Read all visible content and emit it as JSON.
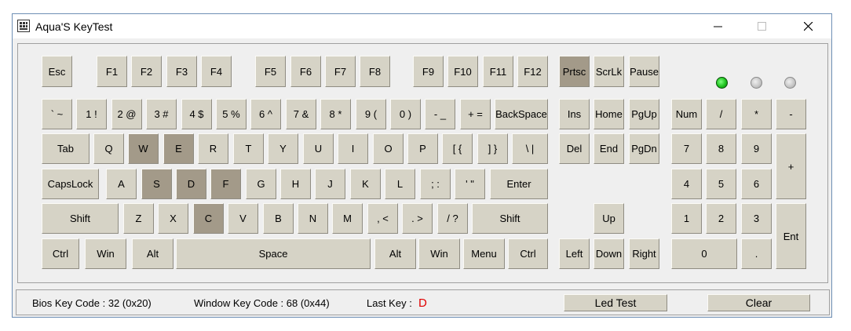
{
  "window": {
    "title": "Aqua'S KeyTest"
  },
  "leds": [
    {
      "name": "led-1",
      "state": "on"
    },
    {
      "name": "led-2",
      "state": "off"
    },
    {
      "name": "led-3",
      "state": "off"
    }
  ],
  "colors": {
    "key_face": "#d6d3c6",
    "key_pressed": "#a39a89",
    "led_on": "#1fc21f",
    "last_key_value": "#e00000"
  },
  "status": {
    "bios_key_code": "Bios Key Code : 32 (0x20)",
    "window_key_code": "Window Key Code : 68 (0x44)",
    "last_key_label": "Last Key :",
    "last_key_value": "D",
    "led_test_label": "Led Test",
    "clear_label": "Clear"
  },
  "keys": [
    {
      "label": "Esc"
    },
    {
      "label": "F1"
    },
    {
      "label": "F2"
    },
    {
      "label": "F3"
    },
    {
      "label": "F4"
    },
    {
      "label": "F5"
    },
    {
      "label": "F6"
    },
    {
      "label": "F7"
    },
    {
      "label": "F8"
    },
    {
      "label": "F9"
    },
    {
      "label": "F10"
    },
    {
      "label": "F11"
    },
    {
      "label": "F12"
    },
    {
      "label": "Prtsc",
      "pressed": true
    },
    {
      "label": "ScrLk"
    },
    {
      "label": "Pause"
    },
    {
      "label": "` ~"
    },
    {
      "label": "1 !"
    },
    {
      "label": "2 @"
    },
    {
      "label": "3 #"
    },
    {
      "label": "4 $"
    },
    {
      "label": "5 %"
    },
    {
      "label": "6 ^"
    },
    {
      "label": "7 &"
    },
    {
      "label": "8 *"
    },
    {
      "label": "9 ("
    },
    {
      "label": "0 )"
    },
    {
      "label": "- _"
    },
    {
      "label": "+ ="
    },
    {
      "label": "BackSpace"
    },
    {
      "label": "Ins"
    },
    {
      "label": "Home"
    },
    {
      "label": "PgUp"
    },
    {
      "label": "Num"
    },
    {
      "label": "/"
    },
    {
      "label": "*"
    },
    {
      "label": "-"
    },
    {
      "label": "Tab"
    },
    {
      "label": "Q"
    },
    {
      "label": "W",
      "pressed": true
    },
    {
      "label": "E",
      "pressed": true
    },
    {
      "label": "R"
    },
    {
      "label": "T"
    },
    {
      "label": "Y"
    },
    {
      "label": "U"
    },
    {
      "label": "I"
    },
    {
      "label": "O"
    },
    {
      "label": "P"
    },
    {
      "label": "[ {"
    },
    {
      "label": "] }"
    },
    {
      "label": "\\ |"
    },
    {
      "label": "Del"
    },
    {
      "label": "End"
    },
    {
      "label": "PgDn"
    },
    {
      "label": "7"
    },
    {
      "label": "8"
    },
    {
      "label": "9"
    },
    {
      "label": "+"
    },
    {
      "label": "CapsLock"
    },
    {
      "label": "A"
    },
    {
      "label": "S",
      "pressed": true
    },
    {
      "label": "D",
      "pressed": true
    },
    {
      "label": "F",
      "pressed": true
    },
    {
      "label": "G"
    },
    {
      "label": "H"
    },
    {
      "label": "J"
    },
    {
      "label": "K"
    },
    {
      "label": "L"
    },
    {
      "label": "; :"
    },
    {
      "label": "' \""
    },
    {
      "label": "Enter"
    },
    {
      "label": "4"
    },
    {
      "label": "5"
    },
    {
      "label": "6"
    },
    {
      "label": "Shift"
    },
    {
      "label": "Z"
    },
    {
      "label": "X"
    },
    {
      "label": "C",
      "pressed": true
    },
    {
      "label": "V"
    },
    {
      "label": "B"
    },
    {
      "label": "N"
    },
    {
      "label": "M"
    },
    {
      "label": ", <"
    },
    {
      "label": ". >"
    },
    {
      "label": "/ ?"
    },
    {
      "label": "Shift"
    },
    {
      "label": "Up"
    },
    {
      "label": "1"
    },
    {
      "label": "2"
    },
    {
      "label": "3"
    },
    {
      "label": "Ent"
    },
    {
      "label": "Ctrl"
    },
    {
      "label": "Win"
    },
    {
      "label": "Alt"
    },
    {
      "label": "Space"
    },
    {
      "label": "Alt"
    },
    {
      "label": "Win"
    },
    {
      "label": "Menu"
    },
    {
      "label": "Ctrl"
    },
    {
      "label": "Left"
    },
    {
      "label": "Down"
    },
    {
      "label": "Right"
    },
    {
      "label": "0"
    },
    {
      "label": "."
    }
  ]
}
